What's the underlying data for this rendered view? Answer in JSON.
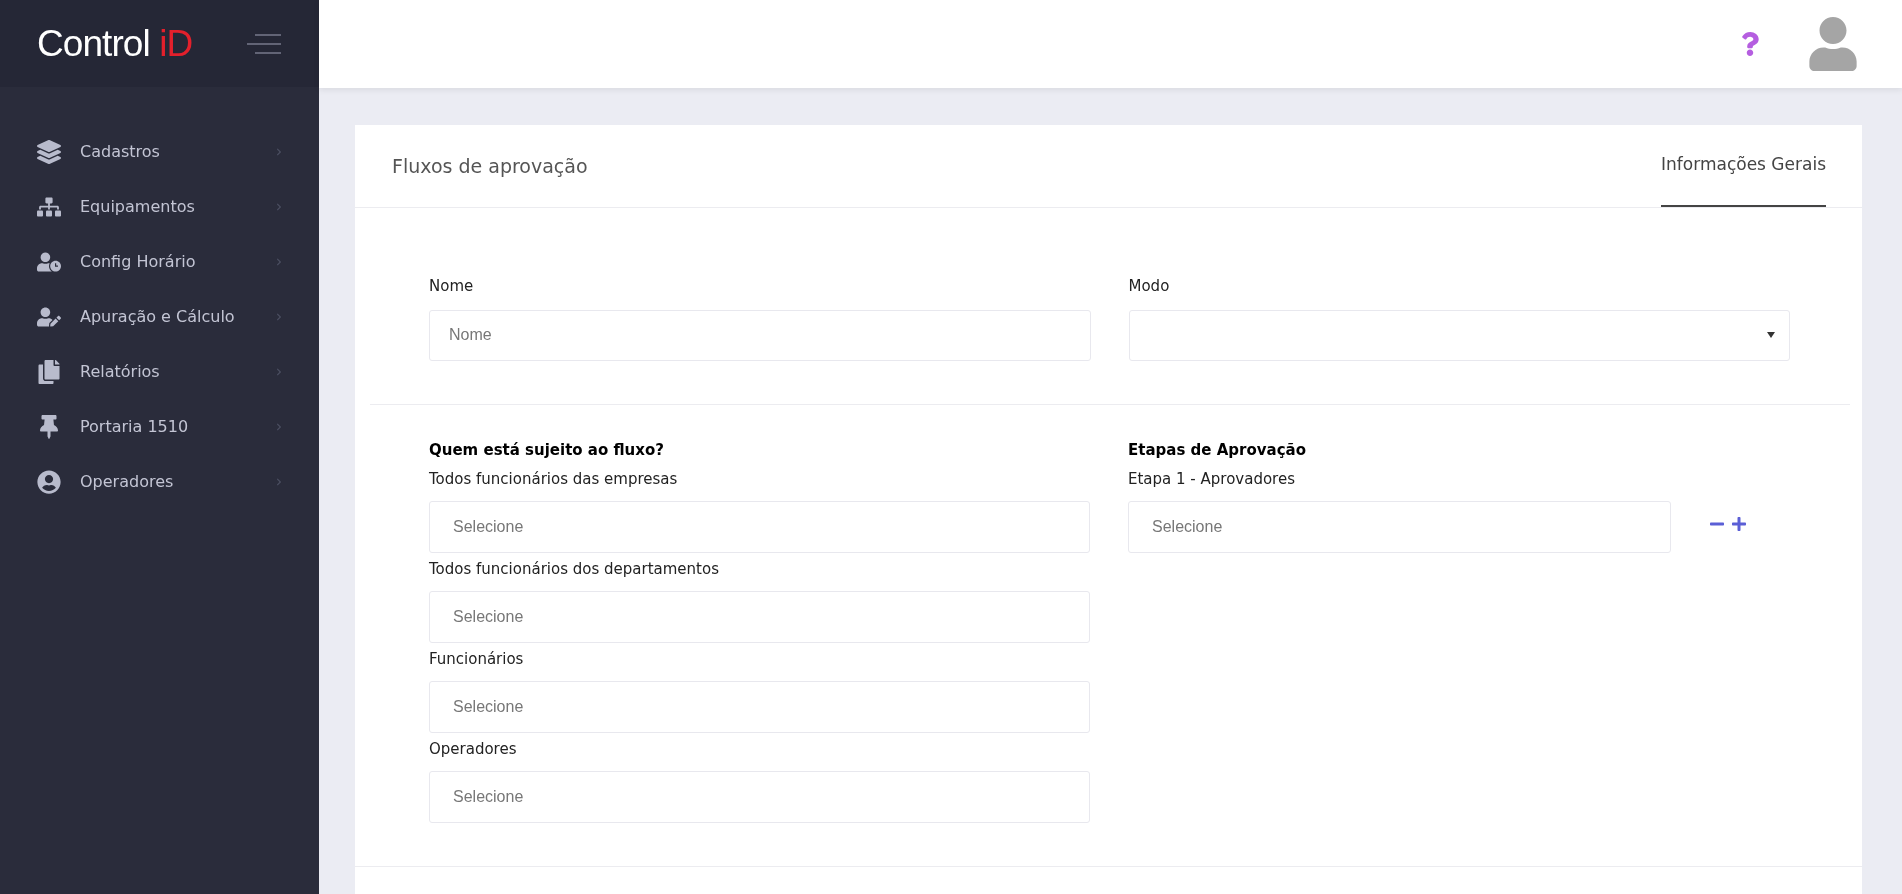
{
  "logo": {
    "text": "Control",
    "accent": "iD"
  },
  "sidebar": {
    "items": [
      {
        "label": "Cadastros"
      },
      {
        "label": "Equipamentos"
      },
      {
        "label": "Config Horário"
      },
      {
        "label": "Apuração e Cálculo"
      },
      {
        "label": "Relatórios"
      },
      {
        "label": "Portaria 1510"
      },
      {
        "label": "Operadores"
      }
    ]
  },
  "page": {
    "title": "Fluxos de aprovação",
    "tabs": [
      {
        "label": "Informações Gerais",
        "selected": true
      }
    ]
  },
  "form": {
    "nome": {
      "label": "Nome",
      "placeholder": "Nome"
    },
    "modo": {
      "label": "Modo"
    }
  },
  "subjects": {
    "heading": "Quem está sujeito ao fluxo?",
    "fields": [
      {
        "label": "Todos funcionários das empresas",
        "placeholder": "Selecione"
      },
      {
        "label": "Todos funcionários dos departamentos",
        "placeholder": "Selecione"
      },
      {
        "label": "Funcionários",
        "placeholder": "Selecione"
      },
      {
        "label": "Operadores",
        "placeholder": "Selecione"
      }
    ]
  },
  "approval": {
    "heading": "Etapas de Aprovação",
    "steps": [
      {
        "label": "Etapa 1 - Aprovadores",
        "placeholder": "Selecione"
      }
    ]
  }
}
